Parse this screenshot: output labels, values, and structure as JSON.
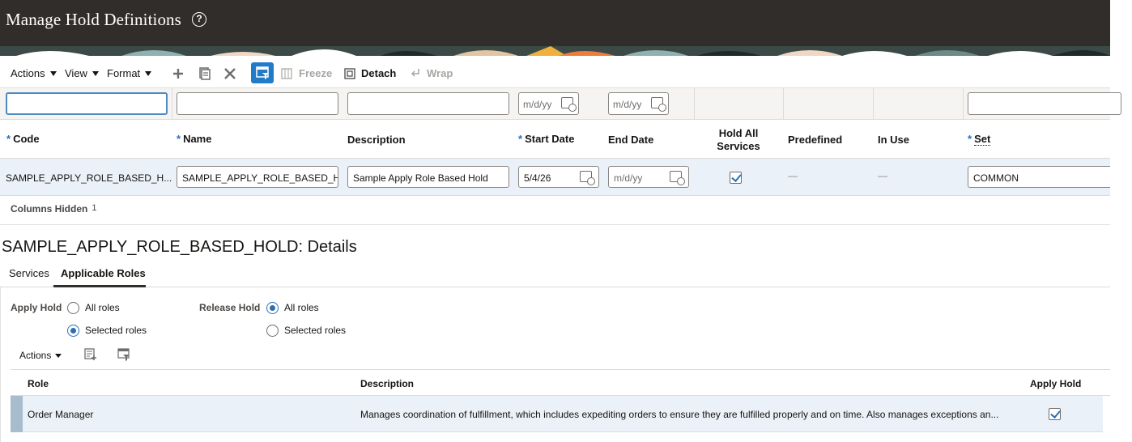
{
  "page": {
    "title": "Manage Hold Definitions",
    "help_icon": "help-circle-icon"
  },
  "toolbar": {
    "actions_label": "Actions",
    "view_label": "View",
    "format_label": "Format",
    "add_icon": "plus-icon",
    "duplicate_icon": "duplicate-icon",
    "delete_icon": "close-icon",
    "query_by_example_icon": "filter-row-icon",
    "freeze_label": "Freeze",
    "detach_label": "Detach",
    "wrap_label": "Wrap"
  },
  "filter": {
    "code_value": "",
    "name_value": "",
    "description_value": "",
    "start_date_placeholder": "m/d/yy",
    "end_date_placeholder": "m/d/yy",
    "set_value": ""
  },
  "columns": {
    "code": "Code",
    "name": "Name",
    "description": "Description",
    "start_date": "Start Date",
    "end_date": "End Date",
    "hold_all_services_line1": "Hold All",
    "hold_all_services_line2": "Services",
    "predefined": "Predefined",
    "in_use": "In Use",
    "set": "Set",
    "required_marker": "*"
  },
  "row": {
    "code": "SAMPLE_APPLY_ROLE_BASED_H...",
    "name": "SAMPLE_APPLY_ROLE_BASED_H",
    "description": "Sample Apply Role Based Hold",
    "start_date": "5/4/26",
    "end_date_placeholder": "m/d/yy",
    "hold_all_services": true,
    "predefined": "—",
    "in_use": "—",
    "set": "COMMON"
  },
  "columns_hidden": {
    "label": "Columns Hidden",
    "count": "1"
  },
  "details": {
    "title": "SAMPLE_APPLY_ROLE_BASED_HOLD: Details",
    "tabs": [
      {
        "label": "Services",
        "active": false
      },
      {
        "label": "Applicable Roles",
        "active": true
      }
    ],
    "apply_hold": {
      "label": "Apply Hold",
      "options": [
        "All roles",
        "Selected roles"
      ],
      "selected": "Selected roles"
    },
    "release_hold": {
      "label": "Release Hold",
      "options": [
        "All roles",
        "Selected roles"
      ],
      "selected": "All roles"
    },
    "roles_toolbar": {
      "actions_label": "Actions",
      "add_icon": "add-row-icon",
      "filter_icon": "filter-row-icon"
    },
    "roles_table": {
      "headers": [
        "Role",
        "Description",
        "Apply Hold"
      ],
      "rows": [
        {
          "role": "Order Manager",
          "description": "Manages coordination of fulfillment, which includes expediting orders to ensure they are fulfilled properly and on time. Also manages exceptions an...",
          "apply_hold": true
        }
      ]
    }
  }
}
